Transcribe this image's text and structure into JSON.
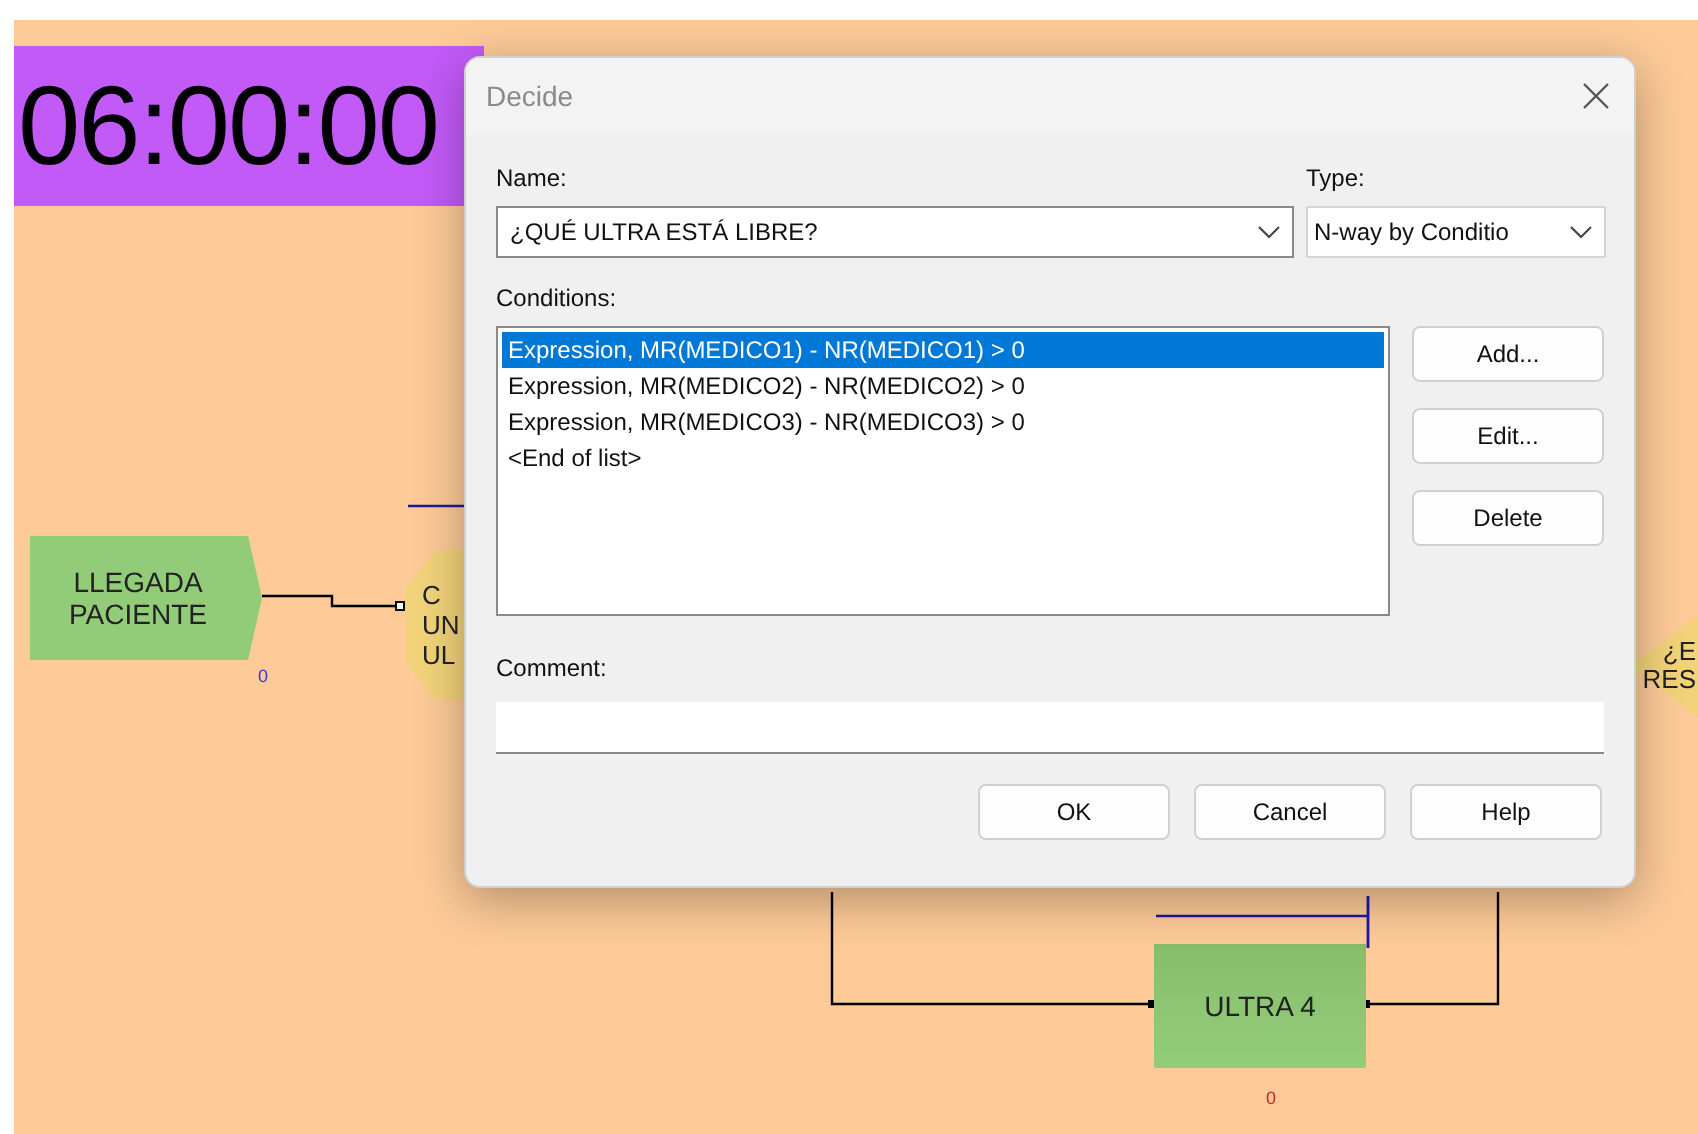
{
  "canvas": {
    "timer": "06:00:00",
    "modules": [
      {
        "kind": "create",
        "lines": [
          "LLEGADA",
          "PACIENTE"
        ],
        "counter": "0"
      },
      {
        "kind": "octagon",
        "lines": [
          "C",
          "UN",
          "UL"
        ]
      },
      {
        "kind": "diamond",
        "lines": [
          "¿E",
          "RES"
        ]
      },
      {
        "kind": "process",
        "lines": [
          "ULTRA 4"
        ],
        "counter": "0"
      }
    ]
  },
  "dialog": {
    "title": "Decide",
    "name_label": "Name:",
    "name_value": "¿QUÉ ULTRA ESTÁ LIBRE?",
    "type_label": "Type:",
    "type_value": "N-way by Conditio",
    "conditions_label": "Conditions:",
    "conditions": [
      {
        "text": "Expression, MR(MEDICO1) - NR(MEDICO1) > 0",
        "selected": true
      },
      {
        "text": "Expression, MR(MEDICO2) - NR(MEDICO2) > 0",
        "selected": false
      },
      {
        "text": "Expression, MR(MEDICO3) - NR(MEDICO3) > 0",
        "selected": false
      },
      {
        "text": "<End of list>",
        "selected": false
      }
    ],
    "side_buttons": [
      "Add...",
      "Edit...",
      "Delete"
    ],
    "comment_label": "Comment:",
    "buttons": [
      "OK",
      "Cancel",
      "Help"
    ]
  }
}
